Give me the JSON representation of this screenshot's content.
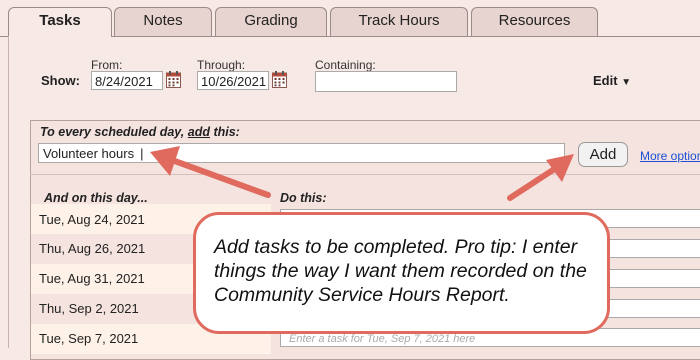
{
  "tabs": [
    {
      "label": "Tasks",
      "active": true
    },
    {
      "label": "Notes"
    },
    {
      "label": "Grading"
    },
    {
      "label": "Track Hours"
    },
    {
      "label": "Resources"
    }
  ],
  "filters": {
    "show_label": "Show:",
    "from_label": "From:",
    "from_value": "8/24/2021",
    "through_label": "Through:",
    "through_value": "10/26/2021",
    "containing_label": "Containing:",
    "containing_value": "",
    "edit_label": "Edit"
  },
  "add_section": {
    "prompt_prefix": "To every scheduled day, ",
    "prompt_link": "add",
    "prompt_suffix": " this:",
    "input_value": "Volunteer hours",
    "add_button": "Add",
    "more_options": "More option"
  },
  "schedule": {
    "col_day": "And on this day...",
    "col_do": "Do this:",
    "rows": [
      {
        "date": "Tue, Aug 24, 2021",
        "placeholder": ""
      },
      {
        "date": "Thu, Aug 26, 2021",
        "placeholder": ""
      },
      {
        "date": "Tue, Aug 31, 2021",
        "placeholder": ""
      },
      {
        "date": "Thu, Sep 2, 2021",
        "placeholder": ""
      },
      {
        "date": "Tue, Sep 7, 2021",
        "placeholder": "Enter a task for Tue, Sep 7, 2021 here"
      }
    ]
  },
  "callout": {
    "text": "Add tasks to be completed. Pro tip: I enter things the way I want them recorded on the Community Service Hours Report."
  },
  "colors": {
    "background": "#f7e9e6",
    "arrow": "#e06a5e",
    "link": "#1a4fd6"
  }
}
